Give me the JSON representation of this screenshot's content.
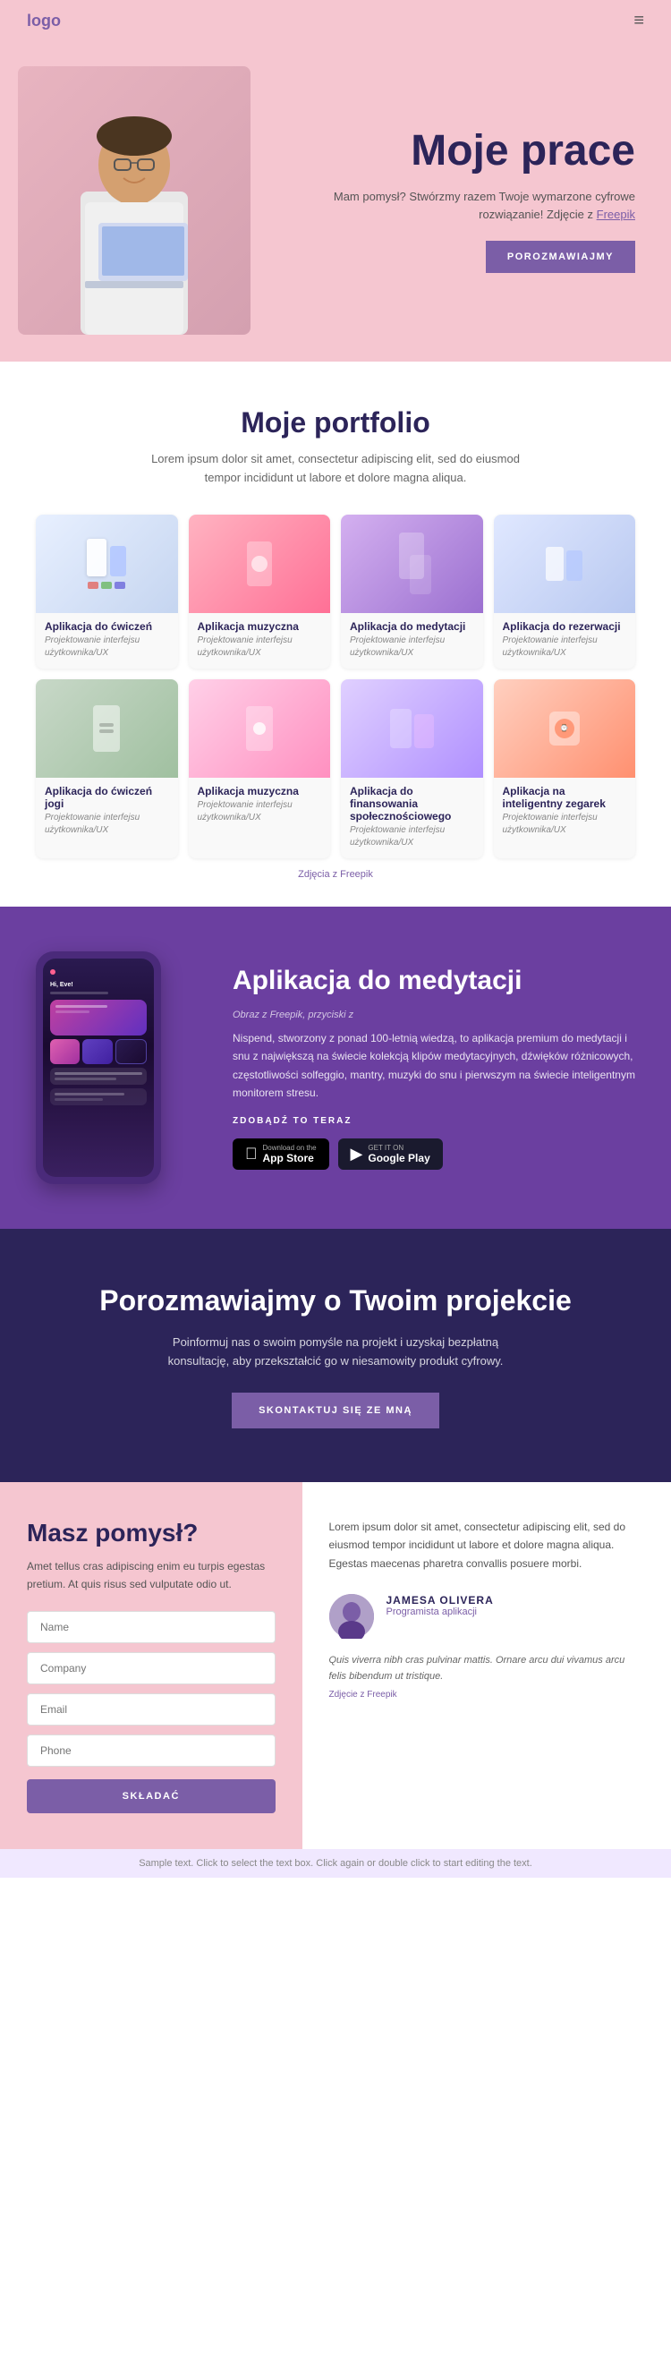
{
  "nav": {
    "logo": "logo",
    "hamburger": "≡"
  },
  "hero": {
    "title": "Moje prace",
    "description": "Mam pomysł? Stwórzmy razem Twoje wymarzone cyfrowe rozwiązanie! Zdjęcie z",
    "freepik_link": "Freepik",
    "button_label": "POROZMAWIAJMY"
  },
  "portfolio": {
    "title": "Moje portfolio",
    "description": "Lorem ipsum dolor sit amet, consectetur adipiscing elit, sed do eiusmod tempor incididunt ut labore et dolore magna aliqua.",
    "credit": "Zdjęcia z Freepik",
    "items": [
      {
        "name": "Aplikacja do ćwiczeń",
        "sub": "Projektowanie interfejsu użytkownika/UX"
      },
      {
        "name": "Aplikacja muzyczna",
        "sub": "Projektowanie interfejsu użytkownika/UX"
      },
      {
        "name": "Aplikacja do medytacji",
        "sub": "Projektowanie interfejsu użytkownika/UX"
      },
      {
        "name": "Aplikacja do rezerwacji",
        "sub": "Projektowanie interfejsu użytkownika/UX"
      },
      {
        "name": "Aplikacja do ćwiczeń jogi",
        "sub": "Projektowanie interfejsu użytkownika/UX"
      },
      {
        "name": "Aplikacja muzyczna",
        "sub": "Projektowanie interfejsu użytkownika/UX"
      },
      {
        "name": "Aplikacja do finansowania społecznościowego",
        "sub": "Projektowanie interfejsu użytkownika/UX"
      },
      {
        "name": "Aplikacja na inteligentny zegarek",
        "sub": "Projektowanie interfejsu użytkownika/UX"
      }
    ]
  },
  "meditation_app": {
    "title": "Aplikacja do medytacji",
    "label": "Obraz z Freepik, przyciski z",
    "description": "Nispend, stworzony z ponad 100-letnią wiedzą, to aplikacja premium do medytacji i snu z największą na świecie kolekcją klipów medytacyjnych, dźwięków różnicowych, częstotliwości solfeggio, mantry, muzyki do snu i pierwszym na świecie inteligentnym monitorem stresu.",
    "cta": "ZDOBĄDŹ TO TERAZ",
    "app_store": {
      "small": "Download on the",
      "big": "App Store"
    },
    "google_play": {
      "small": "GET IT ON",
      "big": "Google Play"
    },
    "phone_greeting": "Hi, Eve!"
  },
  "cta_section": {
    "title": "Porozmawiajmy o Twoim projekcie",
    "description": "Poinformuj nas o swoim pomyśle na projekt i uzyskaj bezpłatną konsultację, aby przekształcić go w niesamowity produkt cyfrowy.",
    "button_label": "SKONTAKTUJ SIĘ ZE MNĄ"
  },
  "contact": {
    "title": "Masz pomysł?",
    "description": "Amet tellus cras adipiscing enim eu turpis egestas pretium. At quis risus sed vulputate odio ut.",
    "fields": {
      "name": "Name",
      "company": "Company",
      "email": "Email",
      "phone": "Phone"
    },
    "submit": "SKŁADAĆ",
    "right_desc": "Lorem ipsum dolor sit amet, consectetur adipiscing elit, sed do eiusmod tempor incididunt ut labore et dolore magna aliqua. Egestas maecenas pharetra convallis posuere morbi.",
    "testimonial": {
      "name": "JAMESA OLIVERA",
      "role": "Programista aplikacji",
      "text": "Quis viverra nibh cras pulvinar mattis. Ornare arcu dui vivamus arcu felis bibendum ut tristique.",
      "credit": "Zdjęcie z Freepik"
    }
  },
  "footer": {
    "text": "Sample text. Click to select the text box. Click again or double click to start editing the text."
  },
  "colors": {
    "purple_dark": "#2c2459",
    "purple_mid": "#6b3fa0",
    "purple_accent": "#7b5ea7",
    "pink_bg": "#f5c6d0"
  }
}
